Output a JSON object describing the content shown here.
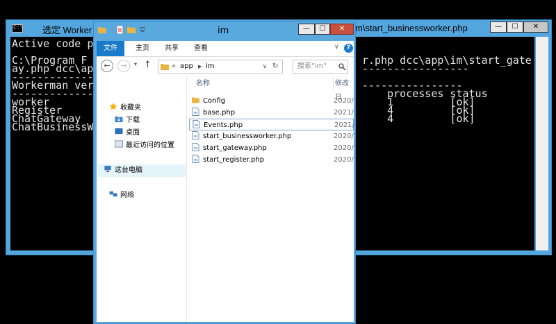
{
  "console": {
    "title_left": "选定 Worker",
    "title_right": "m\\start_businessworker.php",
    "buttons": {
      "minimize": "—",
      "maximize": "☐",
      "close": "✕"
    },
    "lines": [
      "Active code p",
      "",
      "C:\\Program F",
      "ay.php dcc\\ap",
      "-------------",
      "Workerman ver",
      "-------------",
      "worker",
      "Register",
      "ChatGateway",
      "ChatBusinessW"
    ],
    "right_lines": [
      "r.php dcc\\app\\im\\start_gate",
      "-----------------",
      "",
      "----------------",
      "    processes status",
      "    1         [ok]",
      "    4         [ok]",
      "    4         [ok]"
    ]
  },
  "explorer": {
    "title": "im",
    "ribbon_tabs": [
      "文件",
      "主页",
      "共享",
      "查看"
    ],
    "help": "?",
    "address_path": [
      "app",
      "im"
    ],
    "search_placeholder": "搜索\"im\"",
    "nav_items": [
      "收藏夹",
      "下载",
      "桌面",
      "最近访问的位置",
      "这台电脑",
      "网络"
    ],
    "columns": {
      "name": "名称",
      "modified": "修改日"
    },
    "files": [
      {
        "name": "Config",
        "date": "2020/",
        "type": "folder"
      },
      {
        "name": "base.php",
        "date": "2021/",
        "type": "file"
      },
      {
        "name": "Events.php",
        "date": "2021/",
        "type": "file"
      },
      {
        "name": "start_businessworker.php",
        "date": "2020/",
        "type": "file"
      },
      {
        "name": "start_gateway.php",
        "date": "2020/",
        "type": "file"
      },
      {
        "name": "start_register.php",
        "date": "2020/",
        "type": "file"
      }
    ]
  },
  "colors": {
    "titlebar": "#59a9df",
    "ribbon_active": "#1979ca",
    "console_bg": "#000000",
    "console_text": "#e6e6e6",
    "folder": "#e8b640"
  }
}
